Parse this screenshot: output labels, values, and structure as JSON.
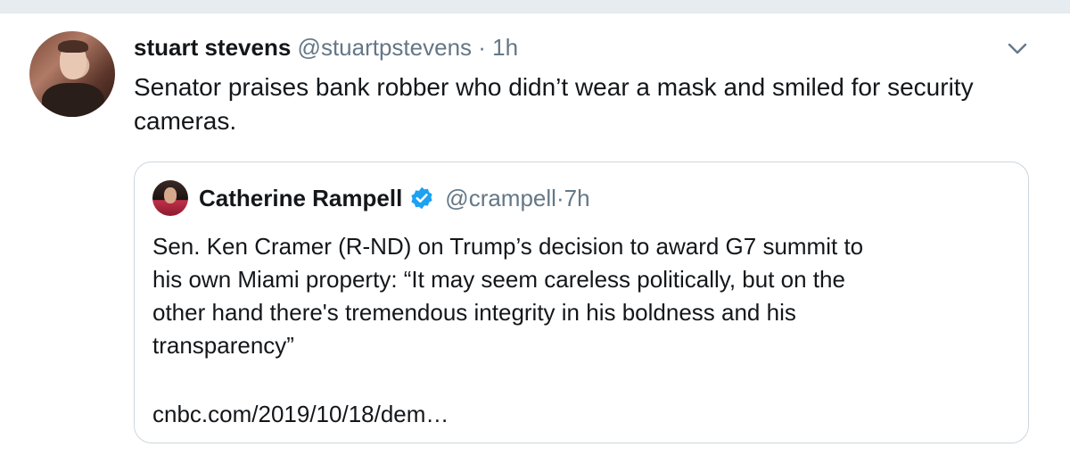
{
  "tweet": {
    "author_name": "stuart stevens",
    "author_handle": "@stuartpstevens",
    "separator": " · ",
    "time": "1h",
    "text": "Senator praises bank robber who didn’t wear a mask and smiled for security cameras."
  },
  "quoted_tweet": {
    "author_name": "Catherine Rampell",
    "author_handle": "@crampell",
    "separator": " · ",
    "time": "7h",
    "text": "Sen. Ken Cramer (R-ND) on Trump’s decision to award G7 summit to\nhis own Miami property: “It may seem careless politically, but on the\nother hand there's tremendous integrity in his boldness and his\ntransparency”",
    "link": "cnbc.com/2019/10/18/dem…"
  },
  "icons": {
    "menu": "chevron-down-icon",
    "verified": "verified-badge-icon"
  },
  "colors": {
    "text_primary": "#14171a",
    "text_secondary": "#657786",
    "verified_blue": "#1da1f2",
    "border": "#ccd6dd",
    "page_background": "#e6ecf0"
  }
}
